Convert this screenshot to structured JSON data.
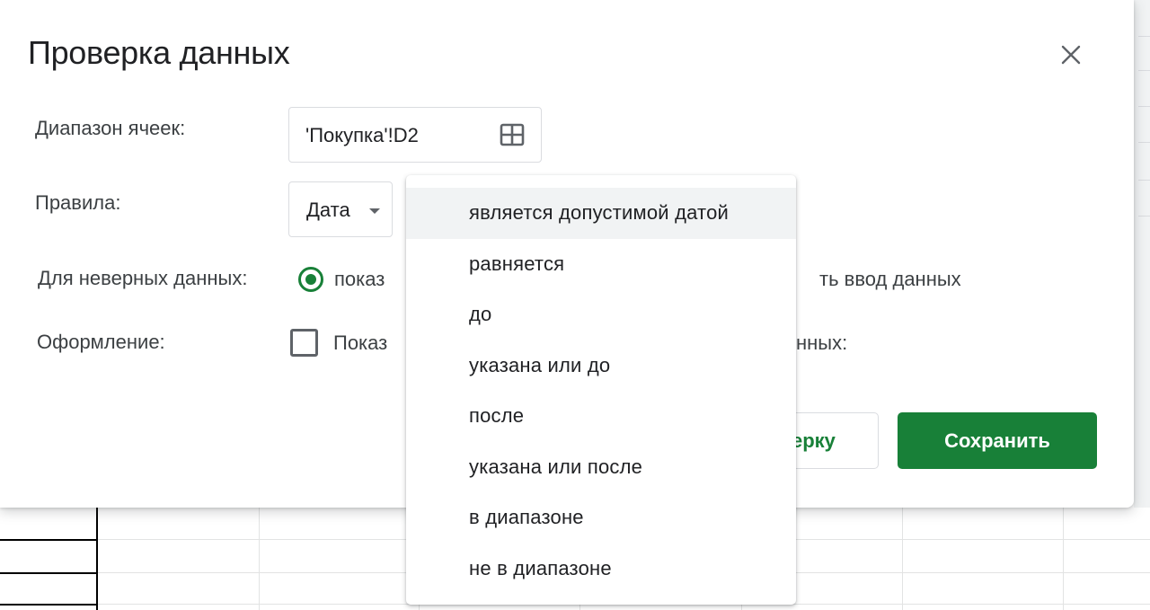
{
  "dialog": {
    "title": "Проверка данных",
    "close_icon": "close-icon"
  },
  "range": {
    "label": "Диапазон ячеек:",
    "value": "'Покупка'!D2",
    "icon": "grid-select-icon"
  },
  "rules": {
    "label": "Правила:",
    "selected": "Дата"
  },
  "invalid_data": {
    "label": "Для неверных данных:",
    "option_show": "показ",
    "option_reject": "ть ввод данных"
  },
  "appearance": {
    "label": "Оформление:",
    "checkbox_text": "Показ",
    "checkbox_suffix": "нных:"
  },
  "buttons": {
    "secondary_label": "ерку",
    "save_label": "Сохранить"
  },
  "condition_menu": {
    "items": [
      "является допустимой датой",
      "равняется",
      "до",
      "указана или до",
      "после",
      "указана или после",
      "в диапазоне",
      "не в диапазоне"
    ],
    "active_index": 0
  },
  "colors": {
    "accent": "#188038",
    "text": "#202124",
    "border": "#dadce0"
  }
}
